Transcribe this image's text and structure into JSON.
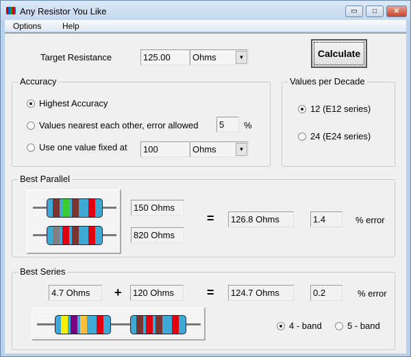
{
  "window": {
    "title": "Any Resistor You Like",
    "minimize": "▭",
    "maximize": "□",
    "close": "✕"
  },
  "menu": [
    "Options",
    "Help"
  ],
  "target": {
    "label": "Target Resistance",
    "value": "125.00",
    "unit": "Ohms",
    "calculate_label": "Calculate"
  },
  "accuracy": {
    "title": "Accuracy",
    "options": [
      "Highest Accuracy",
      "Values nearest each other,  error allowed",
      "Use one value fixed at"
    ],
    "selected": 0,
    "error_allowed": "5",
    "percent": "%",
    "fixed_value": "100",
    "fixed_unit": "Ohms"
  },
  "decade": {
    "title": "Values per Decade",
    "options": [
      "12  (E12 series)",
      "24  (E24 series)"
    ],
    "selected": 0
  },
  "parallel": {
    "title": "Best Parallel",
    "r1": "150 Ohms",
    "r2": "820 Ohms",
    "equals": "=",
    "result": "126.8 Ohms",
    "error": "1.4",
    "error_label": "% error",
    "bands": [
      [
        "#7b3530",
        "#3ccc30",
        "#7b3530",
        "#e00010"
      ],
      [
        "#808080",
        "#e00010",
        "#7b3530",
        "#e00010"
      ]
    ]
  },
  "series": {
    "title": "Best Series",
    "r1": "4.7 Ohms",
    "plus": "+",
    "r2": "120 Ohms",
    "equals": "=",
    "result": "124.7 Ohms",
    "error": "0.2",
    "error_label": "% error",
    "band_options": [
      "4 - band",
      "5 - band"
    ],
    "band_selected": 0,
    "bands": [
      [
        "#f5f000",
        "#7a0080",
        "#ffc040",
        "#e00010"
      ],
      [
        "#7b3530",
        "#e00010",
        "#7b3530",
        "#e00010"
      ]
    ]
  }
}
